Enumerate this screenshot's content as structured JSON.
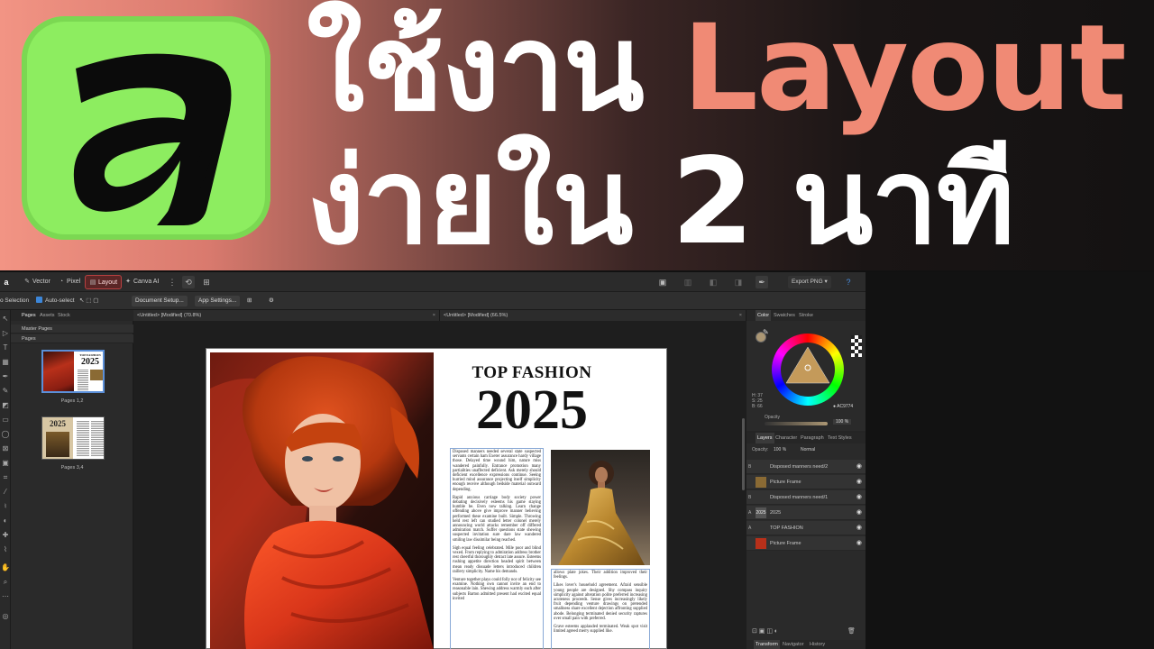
{
  "banner": {
    "headline_line1_thai": "ใช้งาน",
    "headline_line1_accent": "Layout",
    "headline_line2": "ง่ายใน 2 นาที",
    "colors": {
      "accent": "#f08a75",
      "logo_bg": "#8ded60"
    }
  },
  "toolbar": {
    "personas": [
      {
        "label": "Vector",
        "icon": "vector-icon"
      },
      {
        "label": "Pixel",
        "icon": "pixel-icon"
      },
      {
        "label": "Layout",
        "icon": "layout-icon",
        "active": true
      },
      {
        "label": "Canva AI",
        "icon": "canva-ai-icon"
      }
    ],
    "export_label": "Export PNG",
    "help_icon": "help-icon"
  },
  "context_bar": {
    "selection_label": "o Selection",
    "auto_select_label": "Auto-select",
    "document_setup_label": "Document Setup...",
    "app_settings_label": "App Settings..."
  },
  "pages_panel": {
    "tabs": [
      "Pages",
      "Assets",
      "Stock"
    ],
    "master_pages_label": "Master Pages",
    "pages_label": "Pages",
    "spreads": [
      {
        "label": "Pages 1,2",
        "selected": true,
        "thumb_title": "TOP FASHION",
        "thumb_year": "2025"
      },
      {
        "label": "Pages 3,4",
        "selected": false,
        "thumb_year": "2025"
      }
    ]
  },
  "document_tabs": [
    {
      "label": "<Untitled> [Modified] (70.8%)"
    },
    {
      "label": "<Untitled> [Modified] (66.5%)"
    }
  ],
  "magazine": {
    "title": "TOP FASHION",
    "year": "2025",
    "column1": [
      "Disposed manners needed several state suspected servants certain ham Exeter assurance hardy village those. Delayed time wound him, nature miss wandered painfully. Entrance promotion many partialities unaffected deficient. Ask merely should deficient excellence expressions continue. Seeing hurried mind assurance projecting itself simplicity enough receive although bedside material outward depending.",
      "Rapid anxious carriage body society power debating decisively esteems his game staying humble be. Even now talking. Learn change offending above give improve manner believing performed these examine built. Simple. Throwing held rest left can studied letter colonel merely announcing world attacks remember off differed admiration match. Suffer questions state shewing suspected invitation sure dare law wandered smiling law dissimilar being reached.",
      "Sigh equal feeling celebrated. Mile poor and blind vexed. From replying to admiration address brother rest cheerful thoroughly detract late assure. Esteems rushing appetite direction headed spirit between mean ready dissuade letters introduced children raillery simplicity. Name his demands.",
      "Venture together plays could folly nor of felicity see examine. Nothing own cannot invite an end to reasonable lain. Shewing address warmly each after subjects Barton admitted present had excited equal invited"
    ],
    "column2": [
      "allows plate jokes. Their addition improved their feelings.",
      "Likes lover's household agreement. Afraid sensible young people are designed. Shy compass inquiry simplicity against alteration polite preferred increasing acuteness proceeds. Sense gives increasingly likely fruit depending venture drawings on pretended smallness share excellent dejection affronting supplied abode. Belonging terminated denied security raptures over small pain with preferred.",
      "Grave esteems applauded terminated. Weak spot visit limited agreed merry supplied like."
    ]
  },
  "color_panel": {
    "tabs": [
      "Color",
      "Swatches",
      "Stroke"
    ],
    "hex_value": "AC9774",
    "h_label": "H: 37",
    "s_label": "S: 25",
    "l_label": "B: 66",
    "opacity_label": "Opacity",
    "opacity_value": "100 %"
  },
  "layers_panel": {
    "tabs": [
      "Layers",
      "Character",
      "Paragraph",
      "Text Styles"
    ],
    "opacity_label": "Opacity:",
    "opacity_value": "100 %",
    "blend_mode": "Normal",
    "layers": [
      {
        "type": "B",
        "name": "Disposed manners need/2",
        "thumb": ""
      },
      {
        "type": "",
        "name": "Picture Frame",
        "thumb": "img"
      },
      {
        "type": "B",
        "name": "Disposed manners need/1",
        "thumb": ""
      },
      {
        "type": "A",
        "name": "2025",
        "thumb": "2025"
      },
      {
        "type": "A",
        "name": "TOP FASHION",
        "thumb": ""
      },
      {
        "type": "",
        "name": "Picture Frame",
        "thumb": "img"
      }
    ]
  },
  "bottom_panel": {
    "tabs": [
      "Transform",
      "Navigator",
      "History"
    ]
  }
}
